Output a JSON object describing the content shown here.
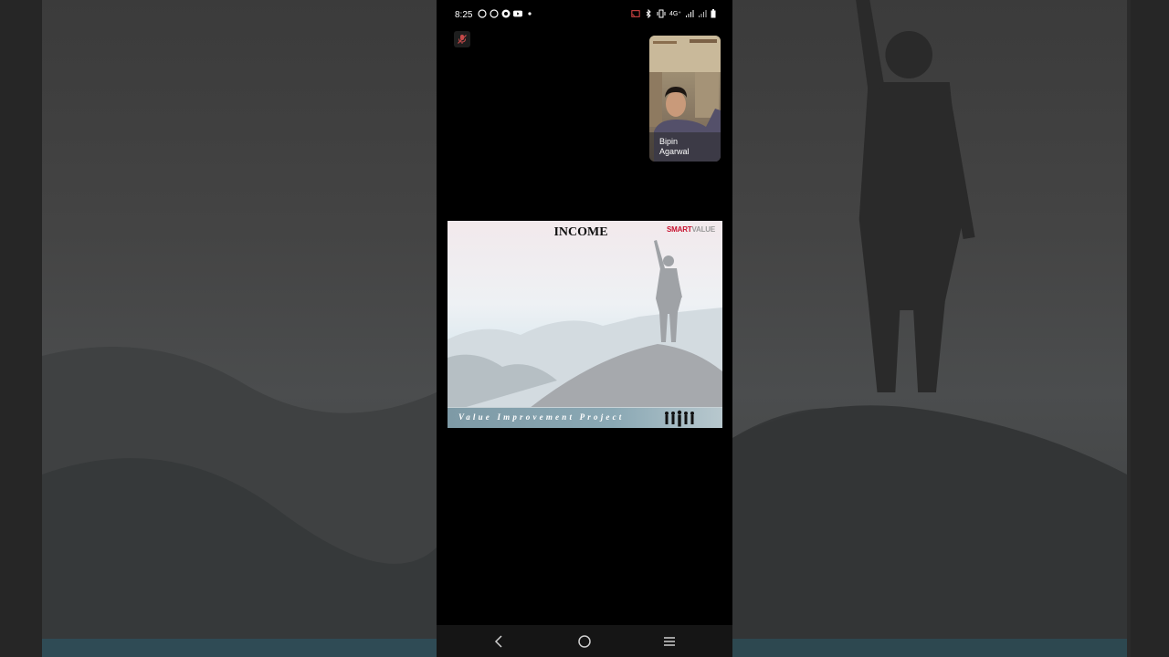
{
  "status_bar": {
    "time": "8:25",
    "network_label": "4G⁺",
    "left_icons": [
      "whatsapp-icon",
      "whatsapp-icon",
      "record-icon",
      "youtube-icon",
      "dot-icon"
    ],
    "right_icons": [
      "cast-icon",
      "bluetooth-icon",
      "vibrate-icon",
      "4g-icon",
      "signal-icon",
      "signal-icon",
      "battery-icon"
    ]
  },
  "call": {
    "mute_icon": "mic-off-icon",
    "participant_name_first": "Bipin",
    "participant_name_last": "Agarwal"
  },
  "slide": {
    "title": "INCOME",
    "logo_part1": "SMART",
    "logo_part2": "VALUE",
    "banner": "Value Improvement Project"
  },
  "nav_bar": {
    "back_icon": "back-icon",
    "home_icon": "home-icon",
    "recents_icon": "recents-icon"
  },
  "colors": {
    "logo_red": "#c8102e",
    "background": "#000000"
  }
}
